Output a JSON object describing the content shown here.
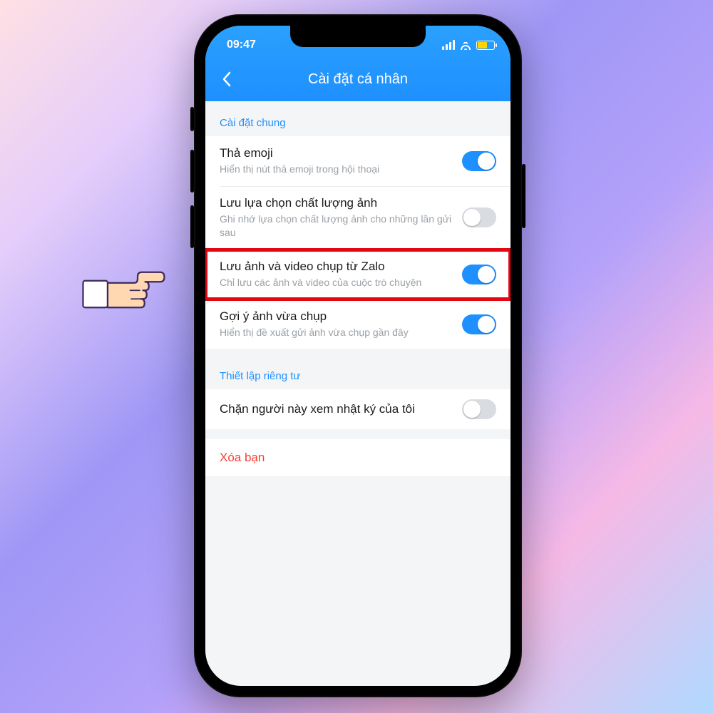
{
  "status": {
    "time": "09:47"
  },
  "header": {
    "title": "Cài đặt cá nhân"
  },
  "sections": {
    "general": {
      "label": "Cài đặt chung",
      "rows": [
        {
          "title": "Thả emoji",
          "sub": "Hiển thị nút thả emoji trong hội thoại",
          "on": true
        },
        {
          "title": "Lưu lựa chọn chất lượng ảnh",
          "sub": "Ghi nhớ lựa chọn chất lượng ảnh cho những lần gửi sau",
          "on": false
        },
        {
          "title": "Lưu ảnh và video chụp từ Zalo",
          "sub": "Chỉ lưu các ảnh và video của cuộc trò chuyện",
          "on": true
        },
        {
          "title": "Gợi ý ảnh vừa chụp",
          "sub": "Hiển thị đề xuất gửi ảnh vừa chụp gần đây",
          "on": true
        }
      ]
    },
    "privacy": {
      "label": "Thiết lập riêng tư",
      "rows": [
        {
          "title": "Chặn người này xem nhật ký của tôi",
          "sub": "",
          "on": false
        }
      ]
    }
  },
  "danger": {
    "label": "Xóa bạn"
  },
  "highlighted_row_index": 2
}
